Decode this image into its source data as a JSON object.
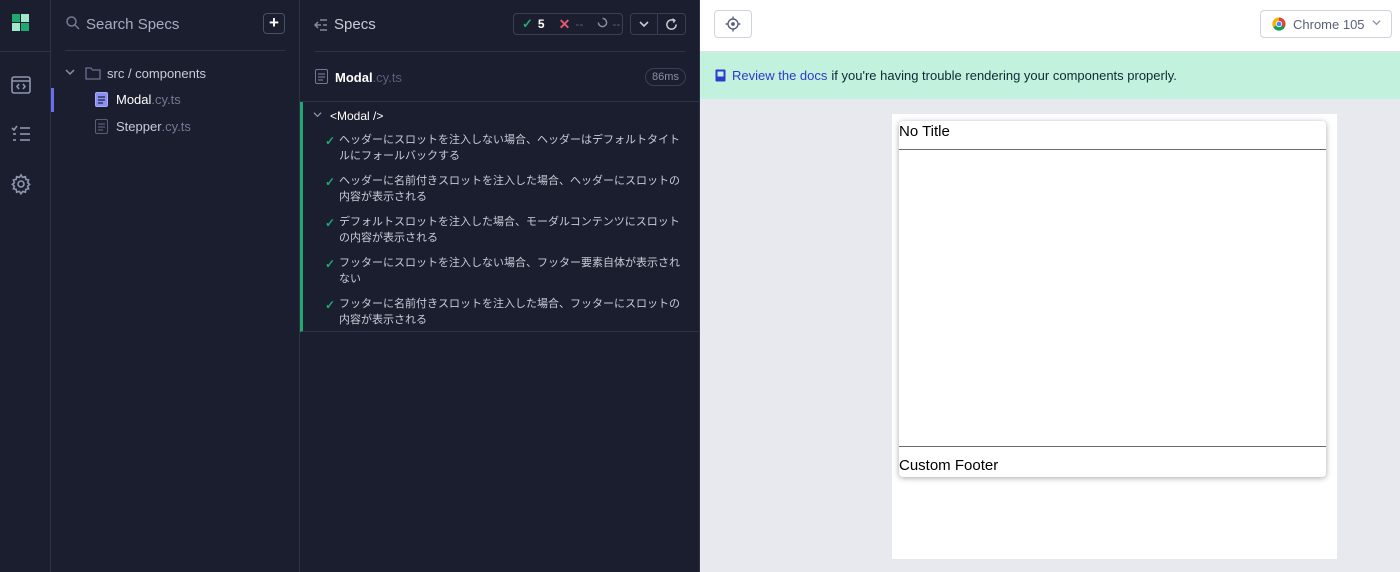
{
  "app": {
    "brand_colors": {
      "logo_dark": "#1fa971",
      "logo_light": "#a3e7cb",
      "accent": "#6970f0"
    }
  },
  "nav": {
    "items": [
      {
        "icon": "specs-icon",
        "label": "Specs"
      },
      {
        "icon": "runs-icon",
        "label": "Runs"
      },
      {
        "icon": "settings-icon",
        "label": "Settings"
      }
    ]
  },
  "sidebar": {
    "search_placeholder": "Search Specs",
    "add_label": "+",
    "folder": "src / components",
    "specs": [
      {
        "name": "Modal",
        "ext": ".cy.ts",
        "active": true
      },
      {
        "name": "Stepper",
        "ext": ".cy.ts",
        "active": false
      }
    ]
  },
  "reporter": {
    "header_title": "Specs",
    "stats": {
      "passed": "5",
      "failed": "--",
      "pending": "--"
    },
    "spec": {
      "name": "Modal",
      "ext": ".cy.ts",
      "duration": "86ms"
    },
    "suite": {
      "title": "<Modal />",
      "tests": [
        "ヘッダーにスロットを注入しない場合、ヘッダーはデフォルトタイトルにフォールバックする",
        "ヘッダーに名前付きスロットを注入した場合、ヘッダーにスロットの内容が表示される",
        "デフォルトスロットを注入した場合、モーダルコンテンツにスロットの内容が表示される",
        "フッターにスロットを注入しない場合、フッター要素自体が表示されない",
        "フッターに名前付きスロットを注入した場合、フッターにスロットの内容が表示される"
      ]
    }
  },
  "preview": {
    "browser": "Chrome 105",
    "banner": {
      "link": "Review the docs",
      "text": "if you're having trouble rendering your components properly."
    },
    "modal": {
      "header": "No Title",
      "footer": "Custom Footer"
    }
  }
}
